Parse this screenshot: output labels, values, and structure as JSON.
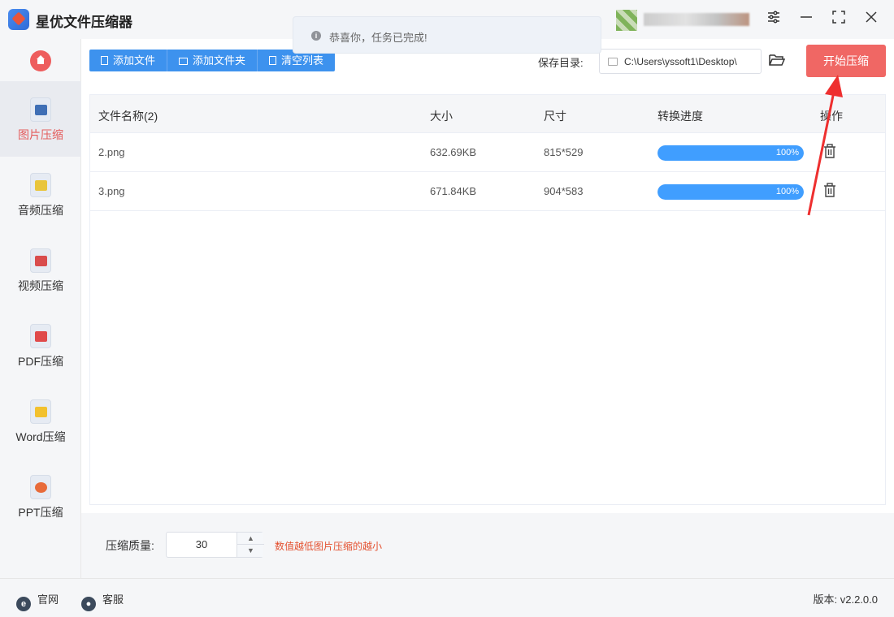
{
  "app": {
    "title": "星优文件压缩器"
  },
  "toast": {
    "text": "恭喜你，任务已完成!"
  },
  "sidebar": {
    "items": [
      {
        "label": "图片压缩",
        "icon": "image-icon",
        "color": "#3f6fb5",
        "active": true
      },
      {
        "label": "音频压缩",
        "icon": "audio-icon",
        "color": "#e9c53b",
        "active": false
      },
      {
        "label": "视频压缩",
        "icon": "video-icon",
        "color": "#d94c4c",
        "active": false
      },
      {
        "label": "PDF压缩",
        "icon": "pdf-icon",
        "color": "#e04a4a",
        "active": false
      },
      {
        "label": "Word压缩",
        "icon": "word-icon",
        "color": "#f2c12e",
        "active": false
      },
      {
        "label": "PPT压缩",
        "icon": "ppt-icon",
        "color": "#e86b3a",
        "active": false
      }
    ]
  },
  "toolbar": {
    "add_file": "添加文件",
    "add_folder": "添加文件夹",
    "clear_list": "清空列表"
  },
  "save": {
    "label": "保存目录:",
    "path": "C:\\Users\\yssoft1\\Desktop\\"
  },
  "start_button": "开始压缩",
  "table": {
    "columns": [
      "文件名称(2)",
      "大小",
      "尺寸",
      "转换进度",
      "操作"
    ],
    "rows": [
      {
        "name": "2.png",
        "size": "632.69KB",
        "dimensions": "815*529",
        "progress": 100,
        "progress_label": "100%"
      },
      {
        "name": "3.png",
        "size": "671.84KB",
        "dimensions": "904*583",
        "progress": 100,
        "progress_label": "100%"
      }
    ]
  },
  "quality": {
    "label": "压缩质量:",
    "value": "30",
    "hint": "数值越低图片压缩的越小"
  },
  "footer": {
    "website": "官网",
    "support": "客服",
    "version": "版本: v2.2.0.0"
  },
  "colors": {
    "accent_blue": "#409eff",
    "start_red": "#f06764",
    "hint_red": "#e4502f"
  }
}
